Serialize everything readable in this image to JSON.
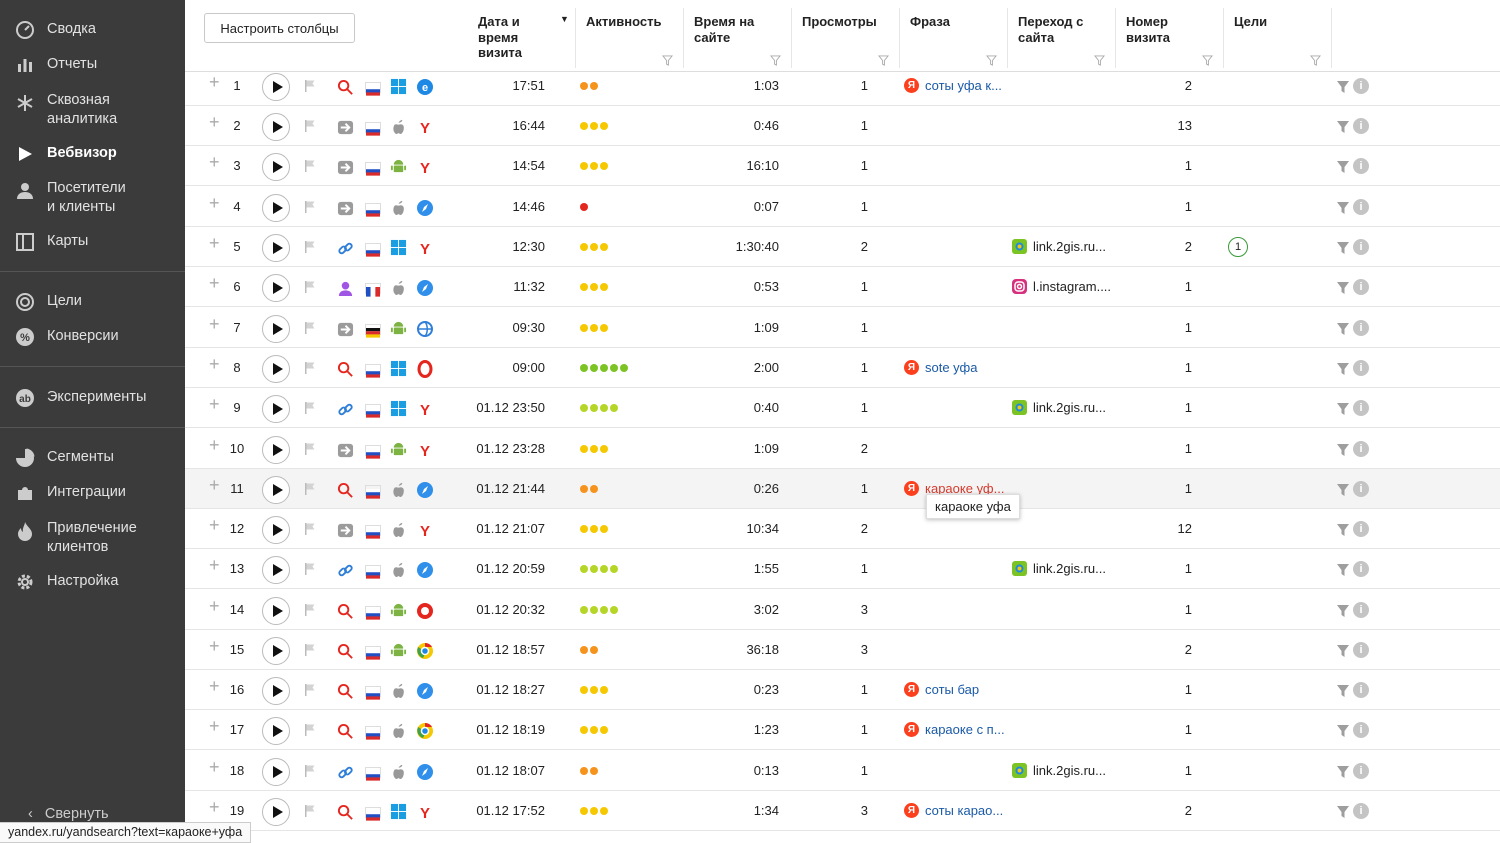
{
  "sidebar": {
    "items": [
      {
        "label": "Сводка",
        "icon": "gauge-icon"
      },
      {
        "label": "Отчеты",
        "icon": "bar-chart-icon"
      },
      {
        "label": "Сквозная\nаналитика",
        "icon": "snowflake-icon"
      },
      {
        "label": "Вебвизор",
        "icon": "play-icon"
      },
      {
        "label": "Посетители\nи клиенты",
        "icon": "person-icon"
      },
      {
        "label": "Карты",
        "icon": "map-icon"
      },
      {
        "label": "Цели",
        "icon": "target-icon"
      },
      {
        "label": "Конверсии",
        "icon": "percent-icon"
      },
      {
        "label": "Эксперименты",
        "icon": "ab-icon"
      },
      {
        "label": "Сегменты",
        "icon": "pie-icon"
      },
      {
        "label": "Интеграции",
        "icon": "puzzle-icon"
      },
      {
        "label": "Привлечение\nклиентов",
        "icon": "flame-icon"
      },
      {
        "label": "Настройка",
        "icon": "gear-icon"
      }
    ],
    "active": "Вебвизор",
    "collapse_label": "Свернуть"
  },
  "status_url": "yandex.ru/yandsearch?text=караоке+уфа",
  "toolbar": {
    "configure_columns": "Настроить столбцы"
  },
  "columns": {
    "datetime": "Дата и\nвремя\nвизита",
    "activity": "Активность",
    "time_on_site": "Время на\nсайте",
    "views": "Просмотры",
    "phrase": "Фраза",
    "referrer": "Переход с\nсайта",
    "visit_number": "Номер\nвизита",
    "goals": "Цели"
  },
  "colors": {
    "orange": "#f6931d",
    "yellow": "#f5c800",
    "red": "#e5261f",
    "green": "#7cc423",
    "lime": "#b5d626"
  },
  "rows": [
    {
      "n": "1",
      "src": "search",
      "flag": "ru",
      "os": "windows",
      "browser": "edge",
      "dt": "17:51",
      "act": [
        "orange",
        "orange"
      ],
      "time": "1:03",
      "views": "1",
      "phrase": "соты уфа к...",
      "ref": "",
      "refIcon": "",
      "visit": "2",
      "goal": ""
    },
    {
      "n": "2",
      "src": "direct",
      "flag": "ru",
      "os": "apple",
      "browser": "yandex",
      "dt": "16:44",
      "act": [
        "yellow",
        "yellow",
        "yellow"
      ],
      "time": "0:46",
      "views": "1",
      "phrase": "",
      "ref": "",
      "refIcon": "",
      "visit": "13",
      "goal": ""
    },
    {
      "n": "3",
      "src": "direct",
      "flag": "ru",
      "os": "android",
      "browser": "yandex",
      "dt": "14:54",
      "act": [
        "yellow",
        "yellow",
        "yellow"
      ],
      "time": "16:10",
      "views": "1",
      "phrase": "",
      "ref": "",
      "refIcon": "",
      "visit": "1",
      "goal": ""
    },
    {
      "n": "4",
      "src": "direct",
      "flag": "ru",
      "os": "apple",
      "browser": "safari",
      "dt": "14:46",
      "act": [
        "red"
      ],
      "time": "0:07",
      "views": "1",
      "phrase": "",
      "ref": "",
      "refIcon": "",
      "visit": "1",
      "goal": ""
    },
    {
      "n": "5",
      "src": "link",
      "flag": "ru",
      "os": "windows",
      "browser": "yandex",
      "dt": "12:30",
      "act": [
        "yellow",
        "yellow",
        "yellow"
      ],
      "time": "1:30:40",
      "views": "2",
      "phrase": "",
      "ref": "link.2gis.ru...",
      "refIcon": "2gis",
      "visit": "2",
      "goal": "1"
    },
    {
      "n": "6",
      "src": "social",
      "flag": "fr",
      "os": "apple",
      "browser": "safari",
      "dt": "11:32",
      "act": [
        "yellow",
        "yellow",
        "yellow"
      ],
      "time": "0:53",
      "views": "1",
      "phrase": "",
      "ref": "l.instagram....",
      "refIcon": "instagram",
      "visit": "1",
      "goal": ""
    },
    {
      "n": "7",
      "src": "direct",
      "flag": "de",
      "os": "android",
      "browser": "yandex-alt",
      "dt": "09:30",
      "act": [
        "yellow",
        "yellow",
        "yellow"
      ],
      "time": "1:09",
      "views": "1",
      "phrase": "",
      "ref": "",
      "refIcon": "",
      "visit": "1",
      "goal": ""
    },
    {
      "n": "8",
      "src": "search",
      "flag": "ru",
      "os": "windows",
      "browser": "opera",
      "dt": "09:00",
      "act": [
        "green",
        "green",
        "green",
        "green",
        "green"
      ],
      "time": "2:00",
      "views": "1",
      "phrase": "sote уфа",
      "ref": "",
      "refIcon": "",
      "visit": "1",
      "goal": ""
    },
    {
      "n": "9",
      "src": "link",
      "flag": "ru",
      "os": "windows",
      "browser": "yandex",
      "dt": "01.12 23:50",
      "act": [
        "lime",
        "lime",
        "lime",
        "lime"
      ],
      "time": "0:40",
      "views": "1",
      "phrase": "",
      "ref": "link.2gis.ru...",
      "refIcon": "2gis",
      "visit": "1",
      "goal": ""
    },
    {
      "n": "10",
      "src": "direct",
      "flag": "ru",
      "os": "android",
      "browser": "yandex",
      "dt": "01.12 23:28",
      "act": [
        "yellow",
        "yellow",
        "yellow"
      ],
      "time": "1:09",
      "views": "2",
      "phrase": "",
      "ref": "",
      "refIcon": "",
      "visit": "1",
      "goal": ""
    },
    {
      "n": "11",
      "src": "search",
      "flag": "ru",
      "os": "apple",
      "browser": "safari",
      "dt": "01.12 21:44",
      "act": [
        "orange",
        "orange"
      ],
      "time": "0:26",
      "views": "1",
      "phrase": "караоке уф...",
      "ref": "",
      "refIcon": "",
      "visit": "1",
      "goal": "",
      "highlight": true
    },
    {
      "n": "12",
      "src": "direct",
      "flag": "ru",
      "os": "apple",
      "browser": "yandex",
      "dt": "01.12 21:07",
      "act": [
        "yellow",
        "yellow",
        "yellow"
      ],
      "time": "10:34",
      "views": "2",
      "phrase": "",
      "ref": "",
      "refIcon": "",
      "visit": "12",
      "goal": ""
    },
    {
      "n": "13",
      "src": "link",
      "flag": "ru",
      "os": "apple",
      "browser": "safari",
      "dt": "01.12 20:59",
      "act": [
        "lime",
        "lime",
        "lime",
        "lime"
      ],
      "time": "1:55",
      "views": "1",
      "phrase": "",
      "ref": "link.2gis.ru...",
      "refIcon": "2gis",
      "visit": "1",
      "goal": ""
    },
    {
      "n": "14",
      "src": "search",
      "flag": "ru",
      "os": "android",
      "browser": "yandex-lite",
      "dt": "01.12 20:32",
      "act": [
        "lime",
        "lime",
        "lime",
        "lime"
      ],
      "time": "3:02",
      "views": "3",
      "phrase": "",
      "ref": "",
      "refIcon": "",
      "visit": "1",
      "goal": ""
    },
    {
      "n": "15",
      "src": "search",
      "flag": "ru",
      "os": "android",
      "browser": "chrome",
      "dt": "01.12 18:57",
      "act": [
        "orange",
        "orange"
      ],
      "time": "36:18",
      "views": "3",
      "phrase": "",
      "ref": "",
      "refIcon": "",
      "visit": "2",
      "goal": ""
    },
    {
      "n": "16",
      "src": "search",
      "flag": "ru",
      "os": "apple",
      "browser": "safari",
      "dt": "01.12 18:27",
      "act": [
        "yellow",
        "yellow",
        "yellow"
      ],
      "time": "0:23",
      "views": "1",
      "phrase": "соты бар",
      "ref": "",
      "refIcon": "",
      "visit": "1",
      "goal": ""
    },
    {
      "n": "17",
      "src": "search",
      "flag": "ru",
      "os": "apple",
      "browser": "chrome",
      "dt": "01.12 18:19",
      "act": [
        "yellow",
        "yellow",
        "yellow"
      ],
      "time": "1:23",
      "views": "1",
      "phrase": "караоке с п...",
      "ref": "",
      "refIcon": "",
      "visit": "1",
      "goal": ""
    },
    {
      "n": "18",
      "src": "link",
      "flag": "ru",
      "os": "apple",
      "browser": "safari",
      "dt": "01.12 18:07",
      "act": [
        "orange",
        "orange"
      ],
      "time": "0:13",
      "views": "1",
      "phrase": "",
      "ref": "link.2gis.ru...",
      "refIcon": "2gis",
      "visit": "1",
      "goal": ""
    },
    {
      "n": "19",
      "src": "search",
      "flag": "ru",
      "os": "windows",
      "browser": "yandex",
      "dt": "01.12 17:52",
      "act": [
        "yellow",
        "yellow",
        "yellow"
      ],
      "time": "1:34",
      "views": "3",
      "phrase": "соты карао...",
      "ref": "",
      "refIcon": "",
      "visit": "2",
      "goal": ""
    }
  ],
  "tooltip": "караоке уфа"
}
